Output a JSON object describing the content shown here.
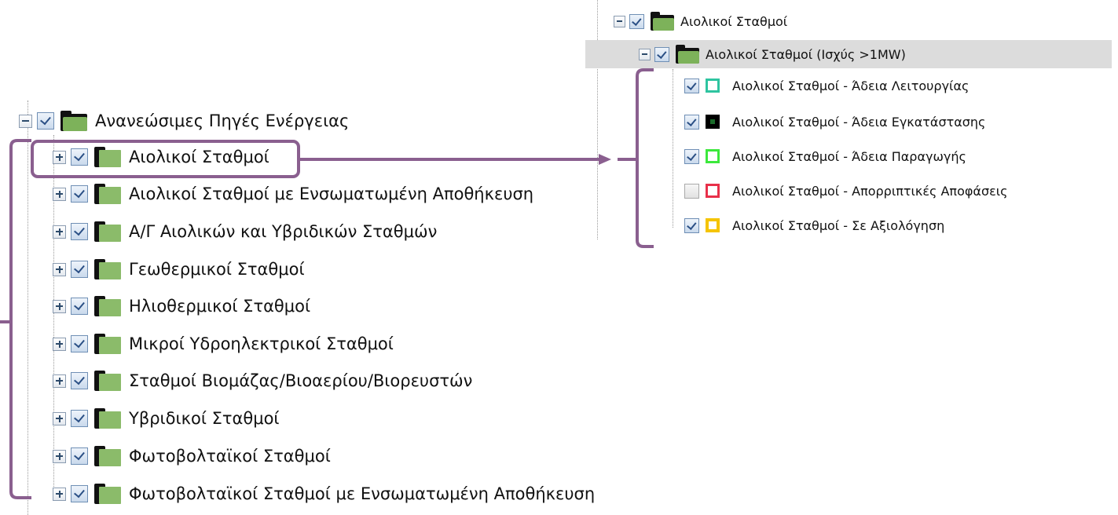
{
  "left_tree": {
    "root": {
      "label": "Ανανεώσιμες Πηγές Ενέργειας",
      "expanded": true,
      "checked": true
    },
    "items": [
      {
        "label": "Αιολικοί Σταθμοί",
        "checked": true,
        "expanded": false,
        "highlighted": true
      },
      {
        "label": "Αιολικοί Σταθμοί με Ενσωματωμένη Αποθήκευση",
        "checked": true,
        "expanded": false
      },
      {
        "label": "Α/Γ Αιολικών και Υβριδικών Σταθμών",
        "checked": true,
        "expanded": false
      },
      {
        "label": "Γεωθερμικοί Σταθμοί",
        "checked": true,
        "expanded": false
      },
      {
        "label": "Ηλιοθερμικοί Σταθμοί",
        "checked": true,
        "expanded": false
      },
      {
        "label": "Μικροί Υδροηλεκτρικοί Σταθμοί",
        "checked": true,
        "expanded": false
      },
      {
        "label": "Σταθμοί Βιομάζας/Βιοαερίου/Βιορευστών",
        "checked": true,
        "expanded": false
      },
      {
        "label": "Υβριδικοί Σταθμοί",
        "checked": true,
        "expanded": false
      },
      {
        "label": "Φωτοβολταϊκοί Σταθμοί",
        "checked": true,
        "expanded": false
      },
      {
        "label": "Φωτοβολταϊκοί Σταθμοί με Ενσωματωμένη Αποθήκευση",
        "checked": true,
        "expanded": false
      }
    ]
  },
  "right_tree": {
    "root": {
      "label": "Αιολικοί Σταθμοί",
      "expanded": true,
      "checked": true
    },
    "group": {
      "label": "Αιολικοί Σταθμοί (Ισχύς >1MW)",
      "expanded": true,
      "checked": true,
      "selected": true
    },
    "layers": [
      {
        "label": "Αιολικοί Σταθμοί - Άδεια Λειτουργίας",
        "checked": true,
        "symbol_border": "#2ec4a0",
        "symbol_fill": "#ffffff"
      },
      {
        "label": "Αιολικοί Σταθμοί - Άδεια Εγκατάστασης",
        "checked": true,
        "symbol_border": "#1a6b2a",
        "symbol_fill": "#000000"
      },
      {
        "label": "Αιολικοί Σταθμοί - Άδεια Παραγωγής",
        "checked": true,
        "symbol_border": "#3ce83c",
        "symbol_fill": "#ffffff"
      },
      {
        "label": "Αιολικοί Σταθμοί - Απορριπτικές Αποφάσεις",
        "checked": false,
        "symbol_border": "#e8304a",
        "symbol_fill": "#ffffff"
      },
      {
        "label": "Αιολικοί Σταθμοί - Σε Αξιολόγηση",
        "checked": true,
        "symbol_border": "#f5c400",
        "symbol_fill": "#ffffff"
      }
    ]
  },
  "colors": {
    "annotation": "#8a5f8f",
    "folder_green": "#7db25a",
    "selection_bg": "#dcdcdc"
  }
}
